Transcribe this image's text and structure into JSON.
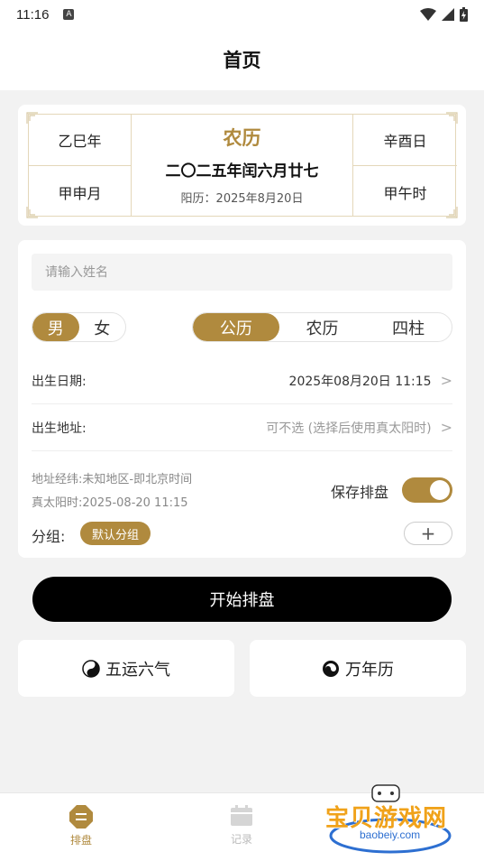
{
  "status": {
    "time": "11:16",
    "badge": "A"
  },
  "header": {
    "title": "首页"
  },
  "calendar": {
    "year_pillar": "乙巳年",
    "month_pillar": "甲申月",
    "day_pillar": "辛酉日",
    "hour_pillar": "甲午时",
    "lunar_label": "农历",
    "lunar_date": "二〇二五年闰六月廿七",
    "solar_date": "阳历：2025年8月20日"
  },
  "form": {
    "name_placeholder": "请输入姓名",
    "gender_options": [
      "男",
      "女"
    ],
    "gender_selected": "男",
    "calendar_options": [
      "公历",
      "农历",
      "四柱"
    ],
    "calendar_selected": "公历",
    "birth_date_label": "出生日期:",
    "birth_date_value": "2025年08月20日 11:15",
    "birth_place_label": "出生地址:",
    "birth_place_value": "可不选 (选择后使用真太阳时)",
    "geo_line": "地址经纬:未知地区-即北京时间",
    "true_solar_line": "真太阳时:2025-08-20 11:15",
    "save_label": "保存排盘",
    "save_enabled": true,
    "group_label": "分组:",
    "group_tag": "默认分组",
    "add_symbol": "+"
  },
  "start_button": "开始排盘",
  "tiles": [
    {
      "label": "五运六气",
      "icon": "yin-yang-icon"
    },
    {
      "label": "万年历",
      "icon": "swirl-icon"
    }
  ],
  "tabbar": {
    "items": [
      {
        "label": "排盘",
        "icon": "chart-icon",
        "active": true
      },
      {
        "label": "记录",
        "icon": "calendar-icon",
        "active": false
      }
    ]
  },
  "watermark": {
    "title": "宝贝游戏网",
    "url": "baobeiy.com"
  },
  "colors": {
    "accent": "#b08a3e",
    "background": "#f2f2f2",
    "primary_button": "#000000"
  }
}
